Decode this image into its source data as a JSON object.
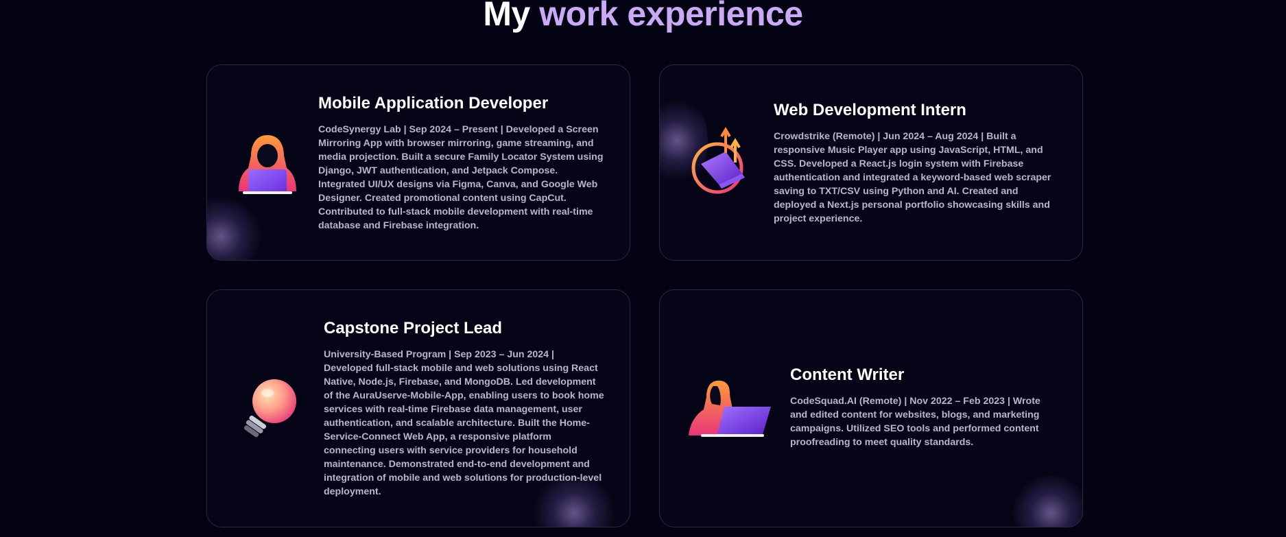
{
  "section": {
    "title_plain": "My ",
    "title_accent": "work experience"
  },
  "experience": [
    {
      "title": "Mobile Application Developer",
      "description": "CodeSynergy Lab | Sep 2024 – Present | Developed a Screen Mirroring App with browser mirroring, game streaming, and media projection. Built a secure Family Locator System using Django, JWT authentication, and Jetpack Compose. Integrated UI/UX designs via Figma, Canva, and Google Web Designer. Created promotional content using CapCut. Contributed to full-stack mobile development with real-time database and Firebase integration.",
      "icon": "hooded-developer-laptop-icon"
    },
    {
      "title": "Web Development Intern",
      "description": "Crowdstrike (Remote) | Jun 2024 – Aug 2024 | Built a responsive Music Player app using JavaScript, HTML, and CSS. Developed a React.js login system with Firebase authentication and integrated a keyword-based web scraper saving to TXT/CSV using Python and AI. Created and deployed a Next.js personal portfolio showcasing skills and project experience.",
      "icon": "growth-laptop-icon"
    },
    {
      "title": "Capstone Project Lead",
      "description": "University-Based Program | Sep 2023 – Jun 2024 | Developed full-stack mobile and web solutions using React Native, Node.js, Firebase, and MongoDB. Led development of the AuraUserve-Mobile-App, enabling users to book home services with real-time Firebase data management, user authentication, and scalable architecture. Built the Home-Service-Connect Web App, a responsive platform connecting users with service providers for household maintenance. Demonstrated end-to-end development and integration of mobile and web solutions for production-level deployment.",
      "icon": "lightbulb-icon"
    },
    {
      "title": "Content Writer",
      "description": "CodeSquad.AI (Remote) | Nov 2022 – Feb 2023 | Wrote and edited content for websites, blogs, and marketing campaigns. Utilized SEO tools and performed content proofreading to meet quality standards.",
      "icon": "hooded-writer-laptop-icon"
    }
  ],
  "colors": {
    "background": "#030314",
    "accent": "#cbaaf5",
    "card_border": "#2a2a40",
    "text_muted": "#b8b7c9"
  }
}
